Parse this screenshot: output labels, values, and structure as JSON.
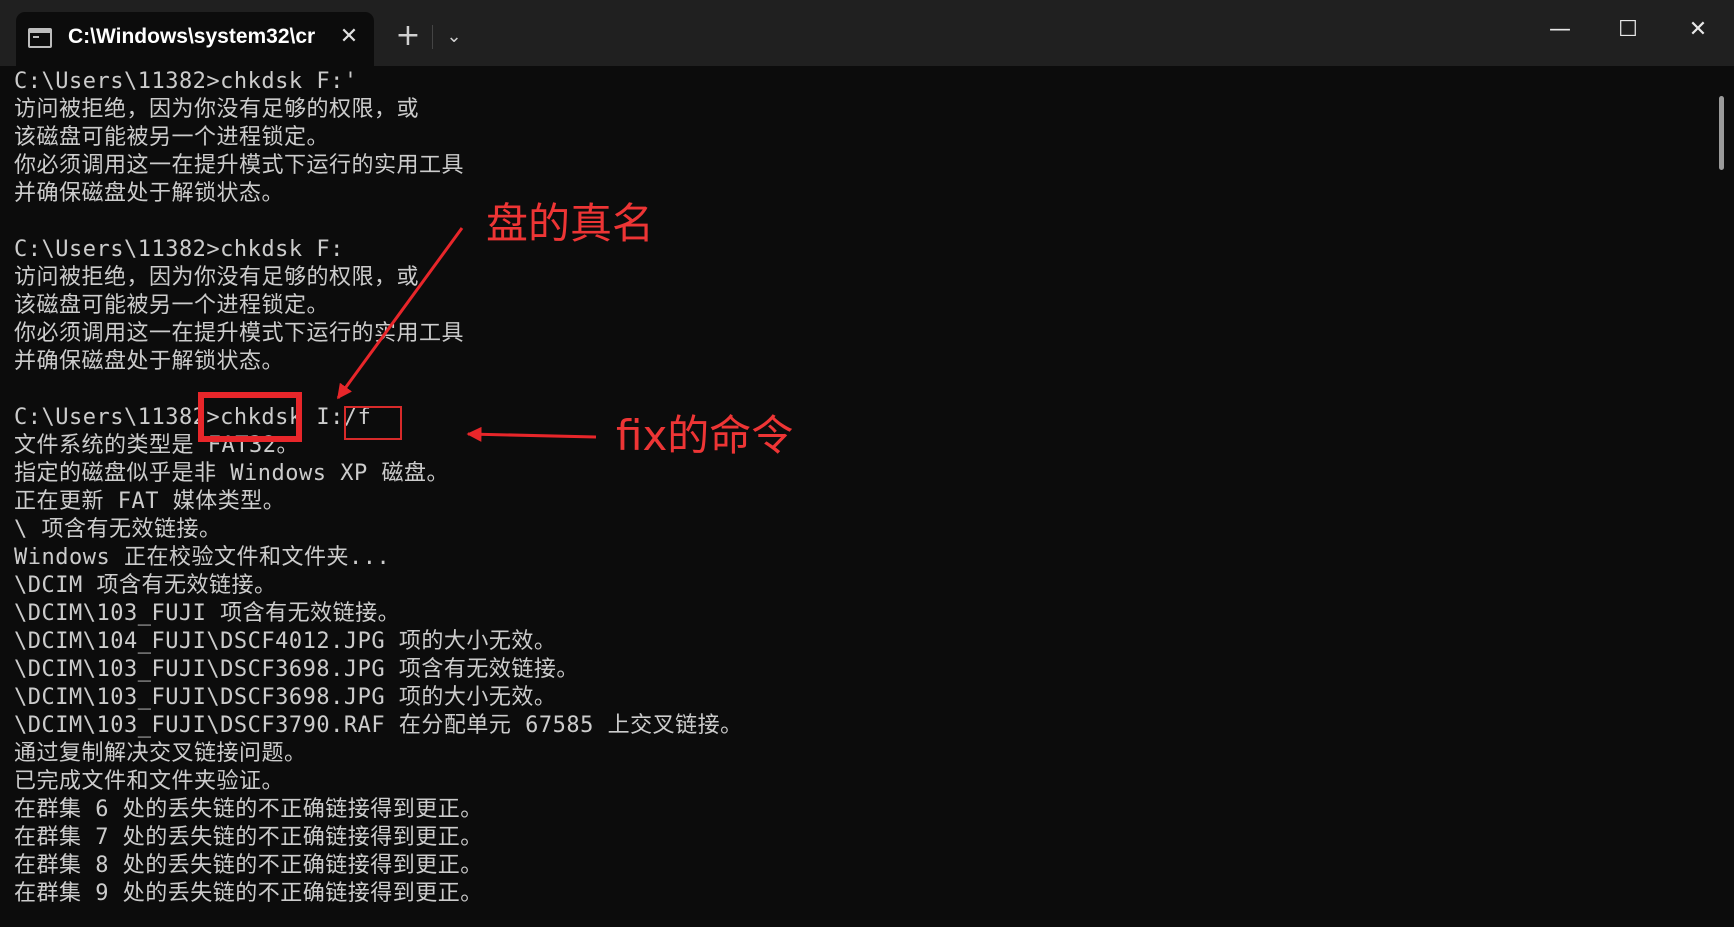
{
  "window": {
    "tab_title": "C:\\Windows\\system32\\cr",
    "tab_close": "✕",
    "new_tab": "+",
    "dropdown": "⌄",
    "minimize": "—",
    "maximize": "☐",
    "close": "✕"
  },
  "console": {
    "lines": [
      "C:\\Users\\11382>chkdsk F:'",
      "访问被拒绝，因为你没有足够的权限，或",
      "该磁盘可能被另一个进程锁定。",
      "你必须调用这一在提升模式下运行的实用工具",
      "并确保磁盘处于解锁状态。",
      "",
      "C:\\Users\\11382>chkdsk F:",
      "访问被拒绝，因为你没有足够的权限，或",
      "该磁盘可能被另一个进程锁定。",
      "你必须调用这一在提升模式下运行的实用工具",
      "并确保磁盘处于解锁状态。",
      "",
      "C:\\Users\\11382>chkdsk I:/f",
      "文件系统的类型是 FAT32。",
      "指定的磁盘似乎是非 Windows XP 磁盘。",
      "正在更新 FAT 媒体类型。",
      "\\ 项含有无效链接。",
      "Windows 正在校验文件和文件夹...",
      "\\DCIM 项含有无效链接。",
      "\\DCIM\\103_FUJI 项含有无效链接。",
      "\\DCIM\\104_FUJI\\DSCF4012.JPG 项的大小无效。",
      "\\DCIM\\103_FUJI\\DSCF3698.JPG 项含有无效链接。",
      "\\DCIM\\103_FUJI\\DSCF3698.JPG 项的大小无效。",
      "\\DCIM\\103_FUJI\\DSCF3790.RAF 在分配单元 67585 上交叉链接。",
      "通过复制解决交叉链接问题。",
      "已完成文件和文件夹验证。",
      "在群集 6 处的丢失链的不正确链接得到更正。",
      "在群集 7 处的丢失链的不正确链接得到更正。",
      "在群集 8 处的丢失链的不正确链接得到更正。",
      "在群集 9 处的丢失链的不正确链接得到更正。"
    ]
  },
  "annotations": {
    "label_disk_name": "盘的真名",
    "label_fix_command": "fix的命令",
    "accent_color": "#e8262a"
  }
}
